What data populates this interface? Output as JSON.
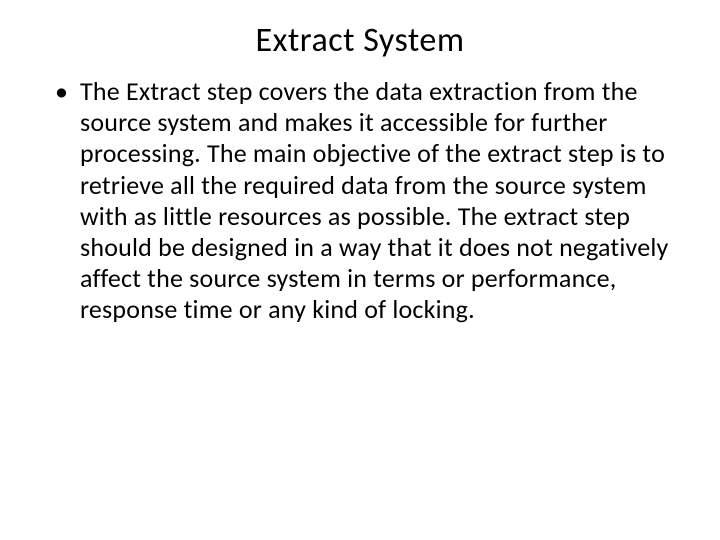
{
  "slide": {
    "title": "Extract System",
    "bullets": [
      {
        "text": "The Extract step covers the data extraction from the source system and makes it accessible for further processing. The main objective of the extract step is to retrieve all the required data from the source system with as little resources as possible. The extract step should be designed in a way that it does not negatively affect the source system in terms or performance, response time or any kind of locking."
      }
    ]
  }
}
